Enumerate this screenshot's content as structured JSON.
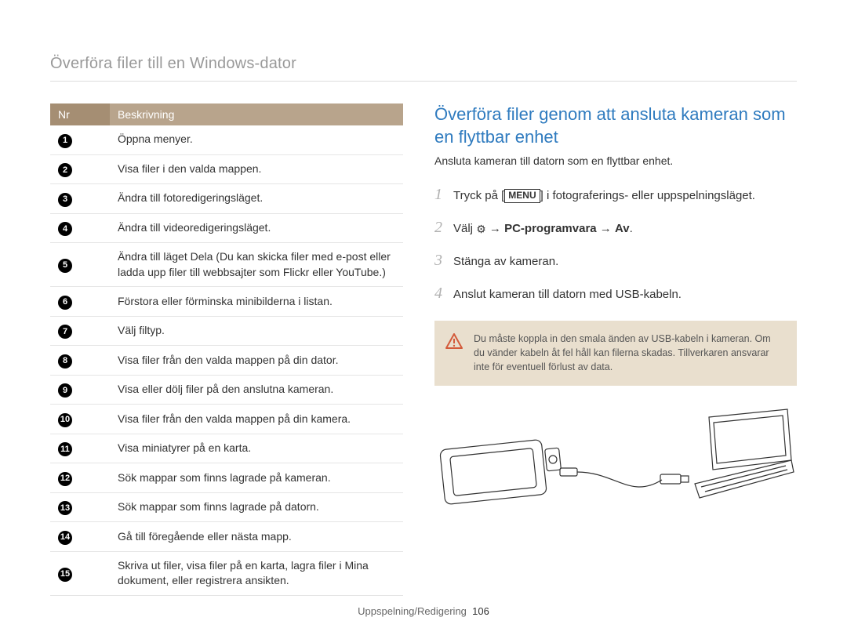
{
  "header": {
    "title": "Överföra filer till en Windows-dator"
  },
  "table": {
    "headers": {
      "num": "Nr",
      "desc": "Beskrivning"
    },
    "rows": [
      {
        "n": "1",
        "d": "Öppna menyer."
      },
      {
        "n": "2",
        "d": "Visa filer i den valda mappen."
      },
      {
        "n": "3",
        "d": "Ändra till fotoredigeringsläget."
      },
      {
        "n": "4",
        "d": "Ändra till videoredigeringsläget."
      },
      {
        "n": "5",
        "d": "Ändra till läget Dela (Du kan skicka filer med e-post eller ladda upp filer till webbsajter som Flickr eller YouTube.)"
      },
      {
        "n": "6",
        "d": "Förstora eller förminska minibilderna i listan."
      },
      {
        "n": "7",
        "d": "Välj filtyp."
      },
      {
        "n": "8",
        "d": "Visa filer från den valda mappen på din dator."
      },
      {
        "n": "9",
        "d": "Visa eller dölj filer på den anslutna kameran."
      },
      {
        "n": "10",
        "d": "Visa filer från den valda mappen på din kamera."
      },
      {
        "n": "11",
        "d": "Visa miniatyrer på en karta."
      },
      {
        "n": "12",
        "d": "Sök mappar som finns lagrade på kameran."
      },
      {
        "n": "13",
        "d": "Sök mappar som finns lagrade på datorn."
      },
      {
        "n": "14",
        "d": "Gå till föregående eller nästa mapp."
      },
      {
        "n": "15",
        "d": "Skriva ut filer, visa filer på en karta, lagra filer i Mina dokument, eller registrera ansikten."
      }
    ]
  },
  "right": {
    "title": "Överföra filer genom att ansluta kameran som en flyttbar enhet",
    "sub": "Ansluta kameran till datorn som en flyttbar enhet.",
    "steps": {
      "s1": {
        "pre": "Tryck på [",
        "key": "MENU",
        "post": "] i fotograferings- eller uppspelningsläget."
      },
      "s2": {
        "pre": "Välj ",
        "icon": "gear-icon",
        "glyph": "⚙",
        "arrow": " → ",
        "bold1": "PC-programvara",
        "mid": " → ",
        "bold2": "Av",
        "end": "."
      },
      "s3": {
        "text": "Stänga av kameran."
      },
      "s4": {
        "text": "Anslut kameran till datorn med USB-kabeln."
      }
    },
    "warn": "Du måste koppla in den smala änden av USB-kabeln i kameran. Om du vänder kabeln åt fel håll kan filerna skadas. Tillverkaren ansvarar inte för eventuell förlust av data."
  },
  "footer": {
    "section": "Uppspelning/Redigering",
    "page": "106"
  }
}
